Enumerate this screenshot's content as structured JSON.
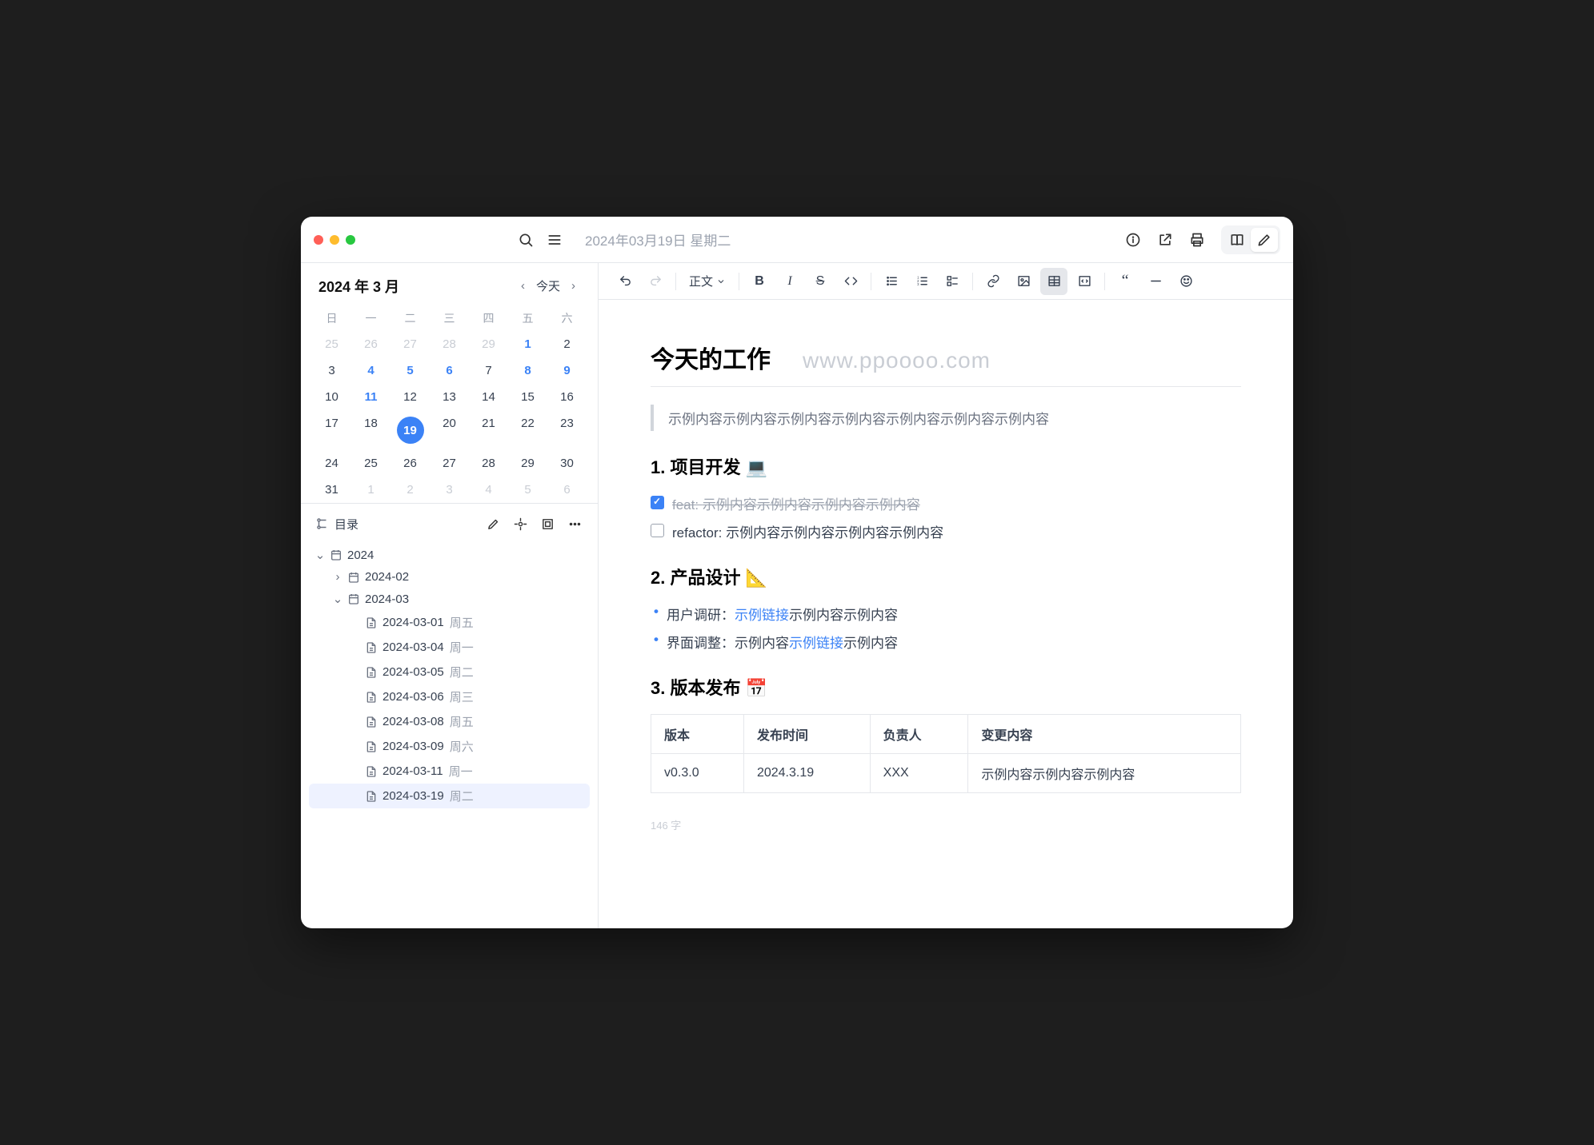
{
  "header": {
    "date_title": "2024年03月19日 星期二"
  },
  "calendar": {
    "title": "2024 年 3 月",
    "today_label": "今天",
    "weekdays": [
      "日",
      "一",
      "二",
      "三",
      "四",
      "五",
      "六"
    ],
    "grid": [
      [
        {
          "d": 25,
          "dim": true
        },
        {
          "d": 26,
          "dim": true
        },
        {
          "d": 27,
          "dim": true
        },
        {
          "d": 28,
          "dim": true
        },
        {
          "d": 29,
          "dim": true
        },
        {
          "d": 1,
          "blue": true
        },
        {
          "d": 2
        }
      ],
      [
        {
          "d": 3
        },
        {
          "d": 4,
          "blue": true
        },
        {
          "d": 5,
          "blue": true
        },
        {
          "d": 6,
          "blue": true
        },
        {
          "d": 7
        },
        {
          "d": 8,
          "blue": true
        },
        {
          "d": 9,
          "blue": true
        }
      ],
      [
        {
          "d": 10
        },
        {
          "d": 11,
          "blue": true
        },
        {
          "d": 12
        },
        {
          "d": 13
        },
        {
          "d": 14
        },
        {
          "d": 15
        },
        {
          "d": 16
        }
      ],
      [
        {
          "d": 17
        },
        {
          "d": 18
        },
        {
          "d": 19,
          "blue": true,
          "selected": true
        },
        {
          "d": 20
        },
        {
          "d": 21
        },
        {
          "d": 22
        },
        {
          "d": 23
        }
      ],
      [
        {
          "d": 24
        },
        {
          "d": 25
        },
        {
          "d": 26
        },
        {
          "d": 27
        },
        {
          "d": 28
        },
        {
          "d": 29
        },
        {
          "d": 30
        }
      ],
      [
        {
          "d": 31
        },
        {
          "d": 1,
          "dim": true
        },
        {
          "d": 2,
          "dim": true
        },
        {
          "d": 3,
          "dim": true
        },
        {
          "d": 4,
          "dim": true
        },
        {
          "d": 5,
          "dim": true
        },
        {
          "d": 6,
          "dim": true
        }
      ]
    ]
  },
  "outline": {
    "title": "目录",
    "nodes": [
      {
        "level": 0,
        "expanded": true,
        "folder": true,
        "label": "2024"
      },
      {
        "level": 1,
        "expanded": false,
        "folder": true,
        "label": "2024-02"
      },
      {
        "level": 1,
        "expanded": true,
        "folder": true,
        "label": "2024-03"
      },
      {
        "level": 2,
        "file": true,
        "label": "2024-03-01",
        "suffix": "周五"
      },
      {
        "level": 2,
        "file": true,
        "label": "2024-03-04",
        "suffix": "周一"
      },
      {
        "level": 2,
        "file": true,
        "label": "2024-03-05",
        "suffix": "周二"
      },
      {
        "level": 2,
        "file": true,
        "label": "2024-03-06",
        "suffix": "周三"
      },
      {
        "level": 2,
        "file": true,
        "label": "2024-03-08",
        "suffix": "周五"
      },
      {
        "level": 2,
        "file": true,
        "label": "2024-03-09",
        "suffix": "周六"
      },
      {
        "level": 2,
        "file": true,
        "label": "2024-03-11",
        "suffix": "周一"
      },
      {
        "level": 2,
        "file": true,
        "label": "2024-03-19",
        "suffix": "周二",
        "selected": true
      }
    ]
  },
  "toolbar": {
    "paragraph_label": "正文"
  },
  "doc": {
    "title": "今天的工作",
    "watermark": "www.ppoooo.com",
    "quote": "示例内容示例内容示例内容示例内容示例内容示例内容示例内容",
    "h1": "1. 项目开发 💻",
    "task1_prefix": "feat: ",
    "task1_text": "示例内容示例内容示例内容示例内容",
    "task2_prefix": "refactor: ",
    "task2_text": "示例内容示例内容示例内容示例内容",
    "h2": "2. 产品设计 📐",
    "b1_pre": "用户调研：",
    "b1_link": "示例链接",
    "b1_post": "示例内容示例内容",
    "b2_pre": "界面调整：示例内容",
    "b2_link": "示例链接",
    "b2_post": "示例内容",
    "h3": "3. 版本发布 📅",
    "th1": "版本",
    "th2": "发布时间",
    "th3": "负责人",
    "th4": "变更内容",
    "td1": "v0.3.0",
    "td2": "2024.3.19",
    "td3": "XXX",
    "td4": "示例内容示例内容示例内容",
    "word_count": "146 字"
  }
}
